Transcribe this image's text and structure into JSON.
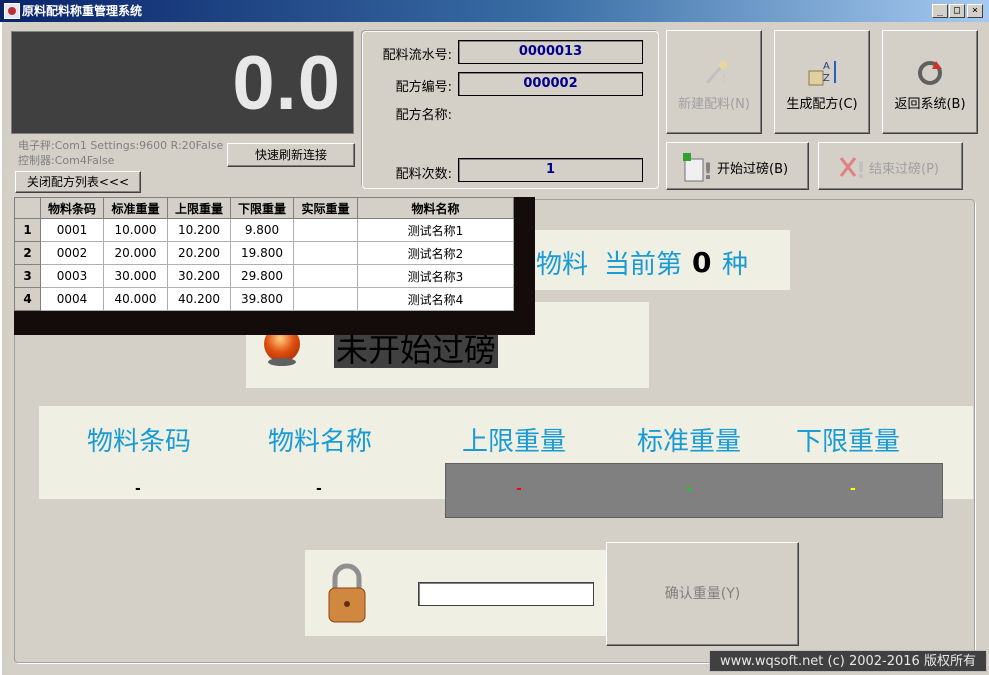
{
  "window": {
    "title": "原料配料称重管理系统",
    "controls": [
      "_",
      "□",
      "×"
    ]
  },
  "scale": {
    "display_value": "0.0",
    "scale_info": "电子秤:Com1 Settings:9600 R:20False",
    "controller_info": "控制器:Com4False",
    "refresh_button": "快速刷新连接",
    "close_list_button": "关闭配方列表<<<"
  },
  "fields": {
    "serial_label": "配料流水号:",
    "serial_value": "0000013",
    "recipe_no_label": "配方编号:",
    "recipe_no_value": "000002",
    "recipe_name_label": "配方名称:",
    "recipe_name_value": "",
    "count_label": "配料次数:",
    "count_value": "1"
  },
  "buttons": {
    "new_batch": "新建配料(N)",
    "gen_recipe": "生成配方(C)",
    "return_system": "返回系统(B)",
    "start_weigh": "开始过磅(B)",
    "end_weigh": "结束过磅(P)",
    "confirm_weight": "确认重量(Y)"
  },
  "table": {
    "headers": [
      "",
      "物料条码",
      "标准重量",
      "上限重量",
      "下限重量",
      "实际重量",
      "物料名称"
    ],
    "rows": [
      [
        "1",
        "0001",
        "10.000",
        "10.200",
        "9.800",
        "",
        "测试名称1"
      ],
      [
        "2",
        "0002",
        "20.000",
        "20.200",
        "19.800",
        "",
        "测试名称2"
      ],
      [
        "3",
        "0003",
        "30.000",
        "30.200",
        "29.800",
        "",
        "测试名称3"
      ],
      [
        "4",
        "0004",
        "40.000",
        "40.200",
        "39.800",
        "",
        "测试名称4"
      ]
    ]
  },
  "material": {
    "prefix": "物料",
    "current_label": "当前第",
    "current_index": "0",
    "unit": "种"
  },
  "status": {
    "text": "未开始过磅",
    "light_color": "#d04010"
  },
  "columns": {
    "code_label": "物料条码",
    "name_label": "物料名称",
    "upper_label": "上限重量",
    "standard_label": "标准重量",
    "lower_label": "下限重量",
    "code_value": "-",
    "name_value": "-",
    "upper_value": "-",
    "standard_value": "-",
    "lower_value": "-",
    "colors": {
      "upper": "#ff0000",
      "standard": "#00e000",
      "lower": "#ffff00"
    }
  },
  "weight_input": {
    "value": ""
  },
  "footer": {
    "copyright": "www.wqsoft.net (c) 2002-2016 版权所有"
  }
}
